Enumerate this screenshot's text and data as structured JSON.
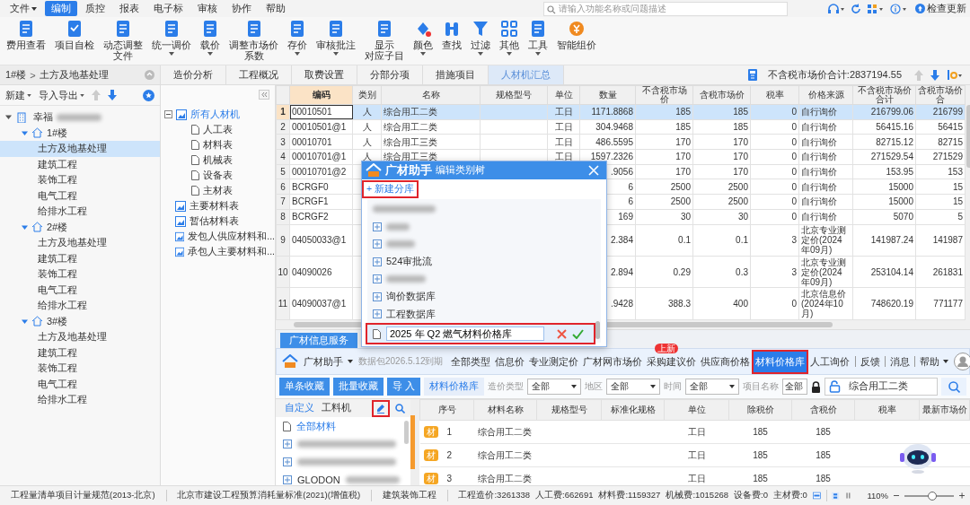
{
  "menu": [
    {
      "label": "文件",
      "dropdown": true,
      "selected": false
    },
    {
      "label": "编制",
      "dropdown": false,
      "selected": true
    },
    {
      "label": "质控",
      "dropdown": false,
      "selected": false
    },
    {
      "label": "报表",
      "dropdown": false,
      "selected": false
    },
    {
      "label": "电子标",
      "dropdown": false,
      "selected": false
    },
    {
      "label": "审核",
      "dropdown": false,
      "selected": false
    },
    {
      "label": "协作",
      "dropdown": false,
      "selected": false
    },
    {
      "label": "帮助",
      "dropdown": false,
      "selected": false
    }
  ],
  "search": {
    "placeholder": "请输入功能名称或问题描述"
  },
  "update_button": "检查更新",
  "ribbon": [
    {
      "lines": [
        "费用查看"
      ],
      "dropdown": false
    },
    {
      "lines": [
        "项目自检"
      ],
      "dropdown": false
    },
    {
      "lines": [
        "动态调整",
        "文件"
      ],
      "dropdown": false
    },
    {
      "lines": [
        "统一调价"
      ],
      "dropdown": true
    },
    {
      "lines": [
        "载价"
      ],
      "dropdown": true
    },
    {
      "lines": [
        "调整市场价",
        "系数"
      ],
      "dropdown": false
    },
    {
      "lines": [
        "存价"
      ],
      "dropdown": true
    },
    {
      "lines": [
        "审核批注"
      ],
      "dropdown": true
    },
    {
      "lines": [
        "显示",
        "对应子目"
      ],
      "dropdown": false
    },
    {
      "lines": [
        "颜色"
      ],
      "dropdown": true
    },
    {
      "lines": [
        "查找"
      ],
      "dropdown": false
    },
    {
      "lines": [
        "过滤"
      ],
      "dropdown": true
    },
    {
      "lines": [
        "其他"
      ],
      "dropdown": true
    },
    {
      "lines": [
        "工具"
      ],
      "dropdown": true
    },
    {
      "lines": [
        "智能组价"
      ],
      "dropdown": false
    }
  ],
  "breadcrumb": {
    "items": [
      "1#楼",
      "土方及地基处理"
    ],
    "separator": ">"
  },
  "left_toolbar": {
    "new": "新建",
    "import_export": "导入导出"
  },
  "project_tree": {
    "label": "幸福",
    "expanded": true,
    "selected": false,
    "children": [
      {
        "label": "1#楼",
        "expanded": true,
        "selected": false,
        "children": [
          {
            "label": "土方及地基处理",
            "selected": true
          },
          {
            "label": "建筑工程",
            "selected": false
          },
          {
            "label": "装饰工程",
            "selected": false
          },
          {
            "label": "电气工程",
            "selected": false
          },
          {
            "label": "给排水工程",
            "selected": false
          }
        ]
      },
      {
        "label": "2#楼",
        "expanded": true,
        "selected": false,
        "children": [
          {
            "label": "土方及地基处理",
            "selected": false
          },
          {
            "label": "建筑工程",
            "selected": false
          },
          {
            "label": "装饰工程",
            "selected": false
          },
          {
            "label": "电气工程",
            "selected": false
          },
          {
            "label": "给排水工程",
            "selected": false
          }
        ]
      },
      {
        "label": "3#楼",
        "expanded": true,
        "selected": false,
        "children": [
          {
            "label": "土方及地基处理",
            "selected": false
          },
          {
            "label": "建筑工程",
            "selected": false
          },
          {
            "label": "装饰工程",
            "selected": false
          },
          {
            "label": "电气工程",
            "selected": false
          },
          {
            "label": "给排水工程",
            "selected": false
          }
        ]
      }
    ]
  },
  "tabs": [
    {
      "label": "造价分析",
      "selected": false
    },
    {
      "label": "工程概况",
      "selected": false
    },
    {
      "label": "取费设置",
      "selected": false
    },
    {
      "label": "分部分项",
      "selected": false
    },
    {
      "label": "措施项目",
      "selected": false
    },
    {
      "label": "人材机汇总",
      "selected": true
    }
  ],
  "total": "不含税市场价合计:2837194.55",
  "category_tree": [
    {
      "label": "所有人材机",
      "selected": true,
      "expanded": true,
      "children": [
        {
          "label": "人工表",
          "selected": false
        },
        {
          "label": "材料表",
          "selected": false
        },
        {
          "label": "机械表",
          "selected": false
        },
        {
          "label": "设备表",
          "selected": false
        },
        {
          "label": "主材表",
          "selected": false
        }
      ]
    },
    {
      "label": "主要材料表",
      "selected": false
    },
    {
      "label": "暂估材料表",
      "selected": false
    },
    {
      "label": "发包人供应材料和...",
      "selected": false
    },
    {
      "label": "承包人主要材料和...",
      "selected": false
    }
  ],
  "table": {
    "columns": [
      "编码",
      "类别",
      "名称",
      "规格型号",
      "单位",
      "数量",
      "不含税市场价",
      "含税市场价",
      "税率",
      "价格来源",
      "不含税市场价合计",
      "含税市场价合"
    ],
    "rows": [
      {
        "num": "1",
        "selected": true,
        "cells": [
          "00010501",
          "人",
          "综合用工二类",
          null,
          "工日",
          "1171.8868",
          "185",
          "185",
          "0",
          "自行询价",
          "216799.06",
          "216799"
        ]
      },
      {
        "num": "2",
        "selected": false,
        "cells": [
          "00010501@1",
          "人",
          "综合用工二类",
          null,
          "工日",
          "304.9468",
          "185",
          "185",
          "0",
          "自行询价",
          "56415.16",
          "56415"
        ]
      },
      {
        "num": "3",
        "selected": false,
        "cells": [
          "00010701",
          "人",
          "综合用工三类",
          null,
          "工日",
          "486.5595",
          "170",
          "170",
          "0",
          "自行询价",
          "82715.12",
          "82715"
        ]
      },
      {
        "num": "4",
        "selected": false,
        "cells": [
          "00010701@1",
          "人",
          "综合用工三类",
          null,
          "工日",
          "1597.2326",
          "170",
          "170",
          "0",
          "自行询价",
          "271529.54",
          "271529"
        ]
      },
      {
        "num": "5",
        "selected": false,
        "cells": [
          "00010701@2",
          null,
          null,
          null,
          null,
          ".9056",
          "170",
          "170",
          "0",
          "自行询价",
          "153.95",
          "153"
        ]
      },
      {
        "num": "6",
        "selected": false,
        "cells": [
          "BCRGF0",
          null,
          null,
          null,
          null,
          "6",
          "2500",
          "2500",
          "0",
          "自行询价",
          "15000",
          "15"
        ]
      },
      {
        "num": "7",
        "selected": false,
        "cells": [
          "BCRGF1",
          null,
          null,
          null,
          null,
          "6",
          "2500",
          "2500",
          "0",
          "自行询价",
          "15000",
          "15"
        ]
      },
      {
        "num": "8",
        "selected": false,
        "cells": [
          "BCRGF2",
          null,
          null,
          null,
          null,
          "169",
          "30",
          "30",
          "0",
          "自行询价",
          "5070",
          "5"
        ]
      },
      {
        "num": "9",
        "selected": false,
        "cells": [
          "04050033@1",
          null,
          null,
          null,
          null,
          "2.384",
          "0.1",
          "0.1",
          "3",
          "北京专业测定价(2024年09月)",
          "141987.24",
          "141987"
        ]
      },
      {
        "num": "10",
        "selected": false,
        "cells": [
          "04090026",
          null,
          null,
          null,
          null,
          "2.894",
          "0.29",
          "0.3",
          "3",
          "北京专业测定价(2024年09月)",
          "253104.14",
          "261831"
        ]
      },
      {
        "num": "11",
        "selected": false,
        "cells": [
          "04090037@1",
          null,
          null,
          null,
          null,
          ".9428",
          "388.3",
          "400",
          "0",
          "北京信息价(2024年10月)",
          "748620.19",
          "771177"
        ]
      }
    ]
  },
  "dialog": {
    "brand": "广材助手",
    "title": "编辑类别树",
    "new_branch": {
      "label": "+ 新建分库",
      "highlighted": true
    },
    "items": [
      {
        "kind": "blurred",
        "expandable": false
      },
      {
        "kind": "blurred",
        "expandable": true
      },
      {
        "kind": "blurred",
        "expandable": true
      },
      {
        "kind": "node",
        "label": "524审批流",
        "expandable": true
      },
      {
        "kind": "blurred",
        "expandable": true
      },
      {
        "kind": "node",
        "label": "询价数据库",
        "expandable": true
      },
      {
        "kind": "node",
        "label": "工程数据库",
        "expandable": true
      }
    ],
    "editor": {
      "value": "2025 年 Q2 燃气材料价格库",
      "highlighted": true
    }
  },
  "info_panel": {
    "tab": "广材信息服务",
    "brand": "广材助手",
    "expiry": "数据包2026.5.12到期",
    "nav": [
      {
        "label": "全部类型",
        "selected": false,
        "highlighted": false
      },
      {
        "label": "信息价",
        "selected": false,
        "highlighted": false
      },
      {
        "label": "专业测定价",
        "selected": false,
        "highlighted": false
      },
      {
        "label": "广材网市场价",
        "selected": false,
        "highlighted": false
      },
      {
        "label": "采购建议价",
        "selected": false,
        "highlighted": false,
        "badge": "上新"
      },
      {
        "label": "供应商价格",
        "selected": false,
        "highlighted": false
      },
      {
        "label": "材料价格库",
        "selected": true,
        "highlighted": true
      },
      {
        "label": "人工询价",
        "selected": false,
        "highlighted": false
      }
    ],
    "links": [
      {
        "label": "反馈",
        "dropdown": false
      },
      {
        "label": "消息",
        "dropdown": false
      },
      {
        "label": "帮助",
        "dropdown": true
      }
    ],
    "actions": [
      "单条收藏",
      "批量收藏",
      "导 入"
    ],
    "library_label": "材料价格库",
    "filters": [
      {
        "label": "造价类型",
        "value": "全部"
      },
      {
        "label": "地区",
        "value": "全部"
      },
      {
        "label": "时间",
        "value": "全部"
      }
    ],
    "project_name": {
      "label": "项目名称",
      "value": "全部"
    },
    "query": "综合用工二类",
    "side_tabs": [
      {
        "label": "自定义",
        "selected": true
      },
      {
        "label": "工料机",
        "selected": false
      }
    ],
    "edit_highlighted": true,
    "materials": [
      {
        "kind": "item",
        "label": "全部材料"
      },
      {
        "kind": "blurred"
      },
      {
        "kind": "blurred"
      },
      {
        "kind": "blurred",
        "label": "GLODON"
      }
    ],
    "columns": [
      "序号",
      "材料名称",
      "规格型号",
      "标准化规格",
      "单位",
      "除税价",
      "含税价",
      "税率",
      "最新市场价"
    ],
    "rows": [
      {
        "badge": "材",
        "num": "1",
        "name": "综合用工二类",
        "unit": "工日",
        "price_ex": "185",
        "price_in": "185"
      },
      {
        "badge": "材",
        "num": "2",
        "name": "综合用工二类",
        "unit": "工日",
        "price_ex": "185",
        "price_in": "185"
      },
      {
        "badge": "材",
        "num": "3",
        "name": "综合用工二类",
        "unit": "工日",
        "price_ex": "185",
        "price_in": "185"
      }
    ]
  },
  "status_bar": {
    "items": [
      "工程量清单项目计量规范(2013-北京)",
      "北京市建设工程预算消耗量标准(2021)(增值税)",
      "建筑装饰工程"
    ],
    "summary": [
      "工程造价:3261338",
      "人工费:662691",
      "材料费:1159327",
      "机械费:1015268",
      "设备费:0",
      "主材费:0"
    ],
    "zoom": "110%",
    "zoom_slider": {
      "level": 0.55
    }
  }
}
